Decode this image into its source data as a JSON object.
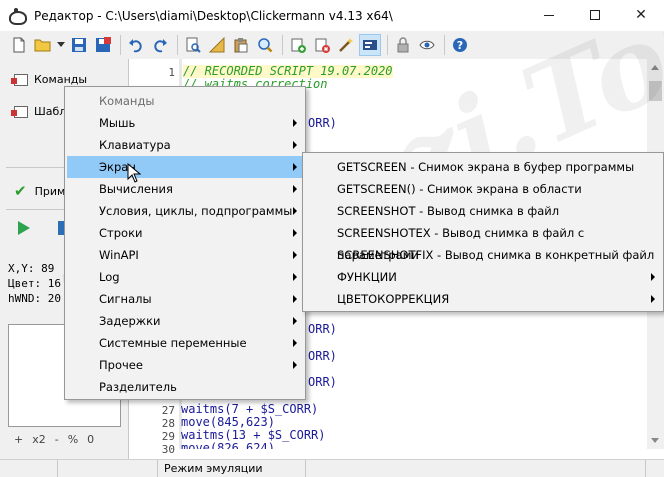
{
  "window": {
    "title": "Редактор - C:\\Users\\diami\\Desktop\\Clickermann v4.13 x64\\",
    "minimize_glyph": "",
    "maximize_glyph": "",
    "close_glyph": "✕"
  },
  "toolbar": {
    "buttons": [
      "new-file-icon",
      "open-folder-icon",
      "dropdown-arrow-icon",
      "save-icon",
      "save-red-icon",
      "undo-icon",
      "redo-icon",
      "find-doc-icon",
      "ruler-icon",
      "clipboard-icon",
      "search-icon",
      "add-doc-icon",
      "delete-doc-icon",
      "magic-wand-icon",
      "record-icon",
      "lock-icon",
      "eye-icon",
      "help-icon"
    ],
    "active_button": "record-icon"
  },
  "left_panel": {
    "items": [
      {
        "label": "Команды"
      },
      {
        "label": "Шабл"
      }
    ],
    "apply_label": "Прим",
    "info": [
      {
        "label": "X,Y:",
        "value": "89"
      },
      {
        "label": "Цвет:",
        "value": "16"
      },
      {
        "label": "hWND:",
        "value": "20"
      }
    ],
    "zoom": [
      "+",
      "x2",
      "-",
      "%",
      "0"
    ]
  },
  "editor": {
    "lines": [
      {
        "num": "1",
        "text": "// RECORDED SCRIPT 19.07.2020"
      },
      {
        "num": "",
        "text": "// waitms correction"
      },
      {
        "num": "",
        "text": "ORR)"
      },
      {
        "num": "",
        "text": "ORR)"
      },
      {
        "num": "",
        "text": "ORR)"
      },
      {
        "num": "",
        "text": "ORR)"
      },
      {
        "num": "27",
        "text": "waitms(7 + $S_CORR)"
      },
      {
        "num": "28",
        "text": "move(845,623)"
      },
      {
        "num": "29",
        "text": "waitms(13 + $S_CORR)"
      },
      {
        "num": "30",
        "text": "move(826,624)"
      }
    ]
  },
  "context_menu": {
    "items": [
      {
        "label": "Команды",
        "disabled": true,
        "submenu": false
      },
      {
        "label": "Мышь",
        "submenu": true
      },
      {
        "label": "Клавиатура",
        "submenu": true
      },
      {
        "label": "Экран",
        "submenu": true,
        "highlighted": true
      },
      {
        "label": "Вычисления",
        "submenu": true
      },
      {
        "label": "Условия, циклы, подпрограммы",
        "submenu": true
      },
      {
        "label": "Строки",
        "submenu": true
      },
      {
        "label": "WinAPI",
        "submenu": true
      },
      {
        "label": "Log",
        "submenu": true
      },
      {
        "label": "Сигналы",
        "submenu": true
      },
      {
        "label": "Задержки",
        "submenu": true
      },
      {
        "label": "Системные переменные",
        "submenu": true
      },
      {
        "label": "Прочее",
        "submenu": true
      },
      {
        "label": "Разделитель",
        "submenu": false
      }
    ]
  },
  "submenu": {
    "items": [
      {
        "label": "GETSCREEN - Снимок экрана в буфер программы",
        "submenu": false
      },
      {
        "label": "GETSCREEN() - Снимок экрана в области",
        "submenu": false
      },
      {
        "label": "SCREENSHOT - Вывод снимка в файл",
        "submenu": false
      },
      {
        "label": "SCREENSHOTEX - Вывод снимка в файл с параметрами",
        "submenu": false
      },
      {
        "label": "SCREENSHOTFIX - Вывод снимка в конкретный файл",
        "submenu": false
      },
      {
        "label": "ФУНКЦИИ",
        "submenu": true
      },
      {
        "label": "ЦВЕТОКОРРЕКЦИЯ",
        "submenu": true
      }
    ]
  },
  "statusbar": {
    "cells": [
      "",
      "",
      "Режим эмуляции",
      ""
    ]
  },
  "watermark": "Zagruzi.Top",
  "colors": {
    "comment": "#2a9d2a",
    "keyword": "#1a1a9a",
    "highlight": "#91c9f7",
    "menu_bg": "#f2f2f2"
  }
}
